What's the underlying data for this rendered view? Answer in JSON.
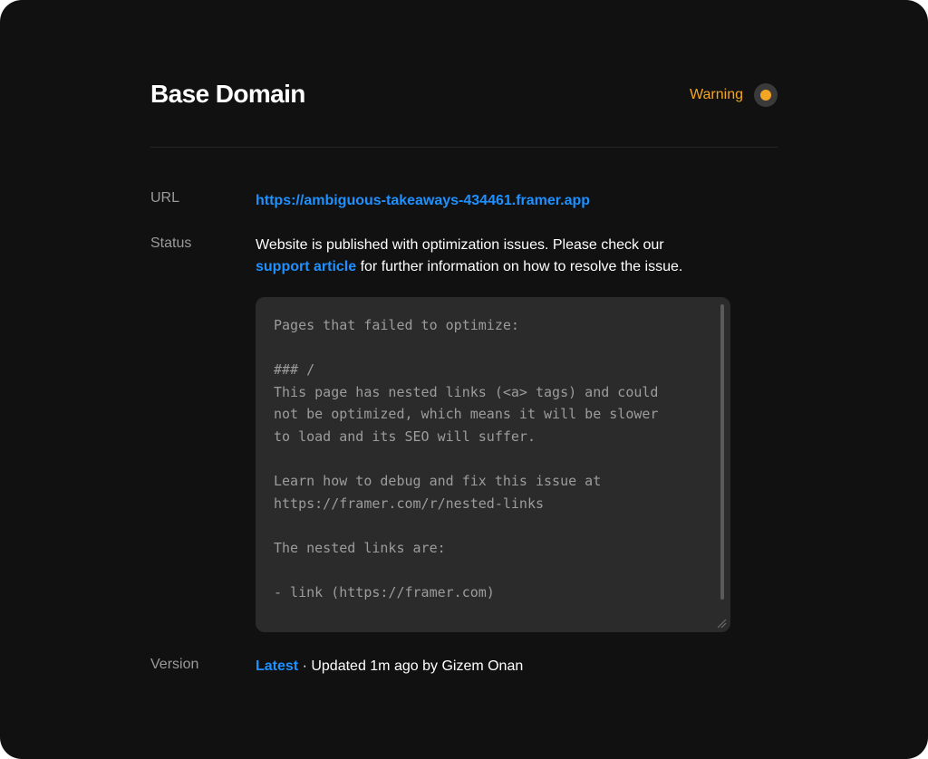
{
  "header": {
    "title": "Base Domain",
    "status_label": "Warning",
    "status_color": "#f5a524",
    "status_icon": "warning-dot-icon"
  },
  "details": {
    "url": {
      "label": "URL",
      "value": "https://ambiguous-takeaways-434461.framer.app"
    },
    "status": {
      "label": "Status",
      "text_before_link": "Website is published with optimization issues. Please check our",
      "link_text": "support article",
      "text_after_link": " for further information on how to resolve the issue.",
      "log": "Pages that failed to optimize:\n\n### /\nThis page has nested links (<a> tags) and could\nnot be optimized, which means it will be slower\nto load and its SEO will suffer.\n\nLearn how to debug and fix this issue at\nhttps://framer.com/r/nested-links\n\nThe nested links are:\n\n- link (https://framer.com)"
    },
    "version": {
      "label": "Version",
      "link_text": "Latest",
      "text": " · Updated 1m ago by Gizem Onan"
    }
  },
  "colors": {
    "background": "#111111",
    "link": "#1e90ff",
    "warning": "#f5a524",
    "log_background": "#2b2b2b"
  }
}
